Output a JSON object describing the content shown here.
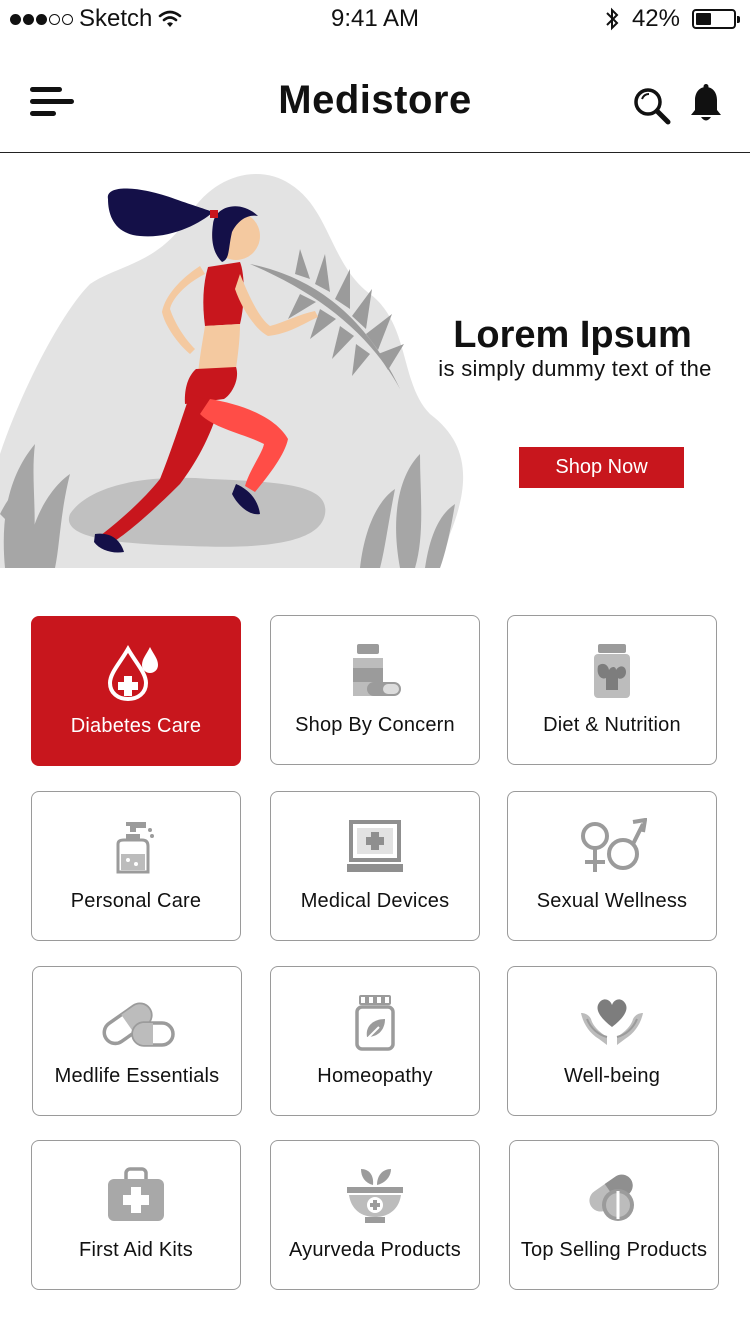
{
  "status_bar": {
    "carrier": "Sketch",
    "time": "9:41 AM",
    "battery_percent": "42%",
    "battery_level": 0.42
  },
  "header": {
    "title": "Medistore"
  },
  "banner": {
    "title": "Lorem Ipsum",
    "subtitle": "is simply dummy text of the",
    "cta": "Shop Now"
  },
  "categories": [
    {
      "label": "Diabetes Care",
      "icon": "blood-drop-icon",
      "active": true
    },
    {
      "label": "Shop By Concern",
      "icon": "medicine-bottle-icon",
      "active": false
    },
    {
      "label": "Diet & Nutrition",
      "icon": "protein-jar-icon",
      "active": false
    },
    {
      "label": "Personal Care",
      "icon": "soap-dispenser-icon",
      "active": false
    },
    {
      "label": "Medical Devices",
      "icon": "medical-monitor-icon",
      "active": false
    },
    {
      "label": "Sexual Wellness",
      "icon": "gender-symbols-icon",
      "active": false
    },
    {
      "label": "Medlife Essentials",
      "icon": "capsule-icon",
      "active": false
    },
    {
      "label": "Homeopathy",
      "icon": "herbal-jar-icon",
      "active": false
    },
    {
      "label": "Well-being",
      "icon": "heart-hands-icon",
      "active": false
    },
    {
      "label": "First Aid Kits",
      "icon": "first-aid-kit-icon",
      "active": false
    },
    {
      "label": "Ayurveda Products",
      "icon": "herbal-bowl-icon",
      "active": false
    },
    {
      "label": "Top Selling Products",
      "icon": "pills-icon",
      "active": false
    }
  ],
  "colors": {
    "accent": "#c8161d",
    "icon_gray": "#9b9b9b",
    "border": "#9a9a9a"
  }
}
